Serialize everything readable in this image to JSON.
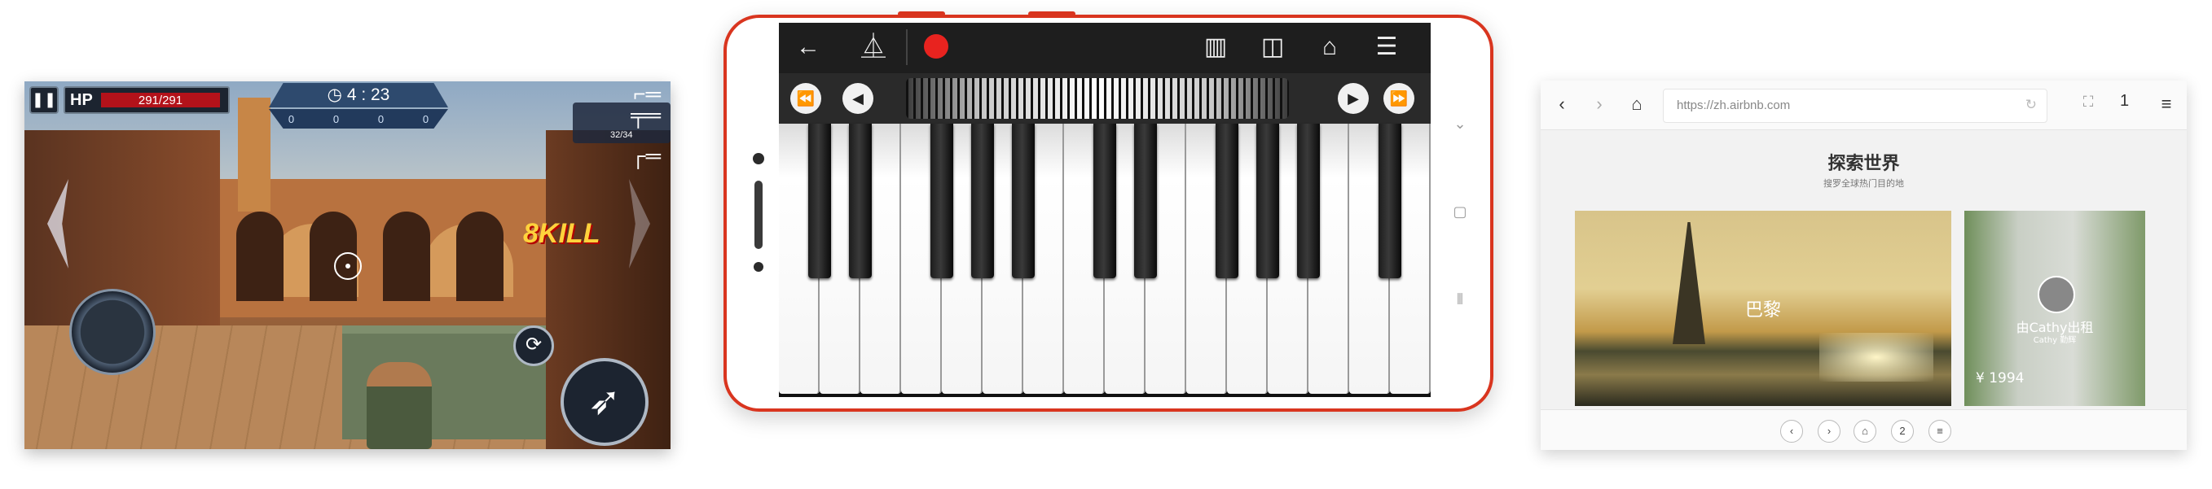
{
  "game": {
    "pause_icon": "pause-icon",
    "hp_label": "HP",
    "hp_value": "291/291",
    "hp_fraction": 1.0,
    "timer": "4 : 23",
    "stats": [
      "0",
      "0",
      "0",
      "0"
    ],
    "kill_text": "KILL",
    "ammo": "32/34",
    "icons": [
      "pause-icon",
      "clock-icon",
      "assault-rifle-icon",
      "reload-icon",
      "fire-icon",
      "joystick"
    ]
  },
  "piano": {
    "toolbar_icons": [
      "back-arrow-icon",
      "metronome-icon",
      "record-icon",
      "keyboard-layout-icon",
      "dual-keyboard-icon",
      "instrument-icon",
      "menu-icon"
    ],
    "accent_color": "#d9351f",
    "record_color": "#e8231f",
    "white_key_count": 16
  },
  "browser": {
    "url": "https://zh.airbnb.com",
    "tab_count": "1",
    "page_title": "探索世界",
    "page_subtitle": "搜罗全球热门目的地",
    "card1_label": "巴黎",
    "card2_name": "由Cathy出租",
    "card2_by": "Cathy 勤辉",
    "card2_price": "¥ 1994",
    "bottom_page": "2"
  }
}
